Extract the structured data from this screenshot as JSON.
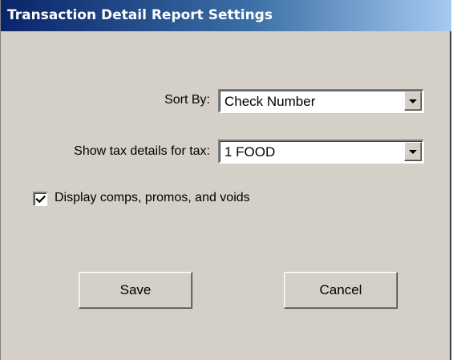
{
  "window": {
    "title": "Transaction Detail Report Settings"
  },
  "form": {
    "sort_by": {
      "label": "Sort By:",
      "value": "Check Number"
    },
    "tax_details": {
      "label": "Show tax details for tax:",
      "value": "1 FOOD"
    },
    "display_comps": {
      "label": "Display comps, promos, and voids",
      "checked": true
    }
  },
  "buttons": {
    "save_label": "Save",
    "cancel_label": "Cancel"
  },
  "colors": {
    "title_gradient_start": "#0a246a",
    "title_gradient_end": "#a6caf0",
    "dialog_background": "#d4d0c8"
  },
  "icons": {
    "dropdown": "chevron-down-icon",
    "checkbox": "checkmark-icon"
  }
}
